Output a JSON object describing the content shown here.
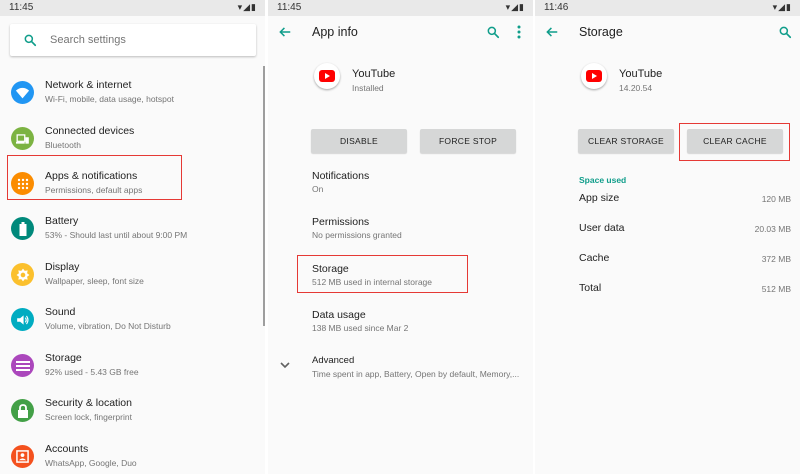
{
  "colors": {
    "network": "#2196f3",
    "connected": "#7cb342",
    "apps": "#fb8c00",
    "battery": "#00897b",
    "display": "#fbc02d",
    "sound": "#00acc1",
    "storage": "#ab47bc",
    "security": "#43a047",
    "accounts": "#f4511e",
    "accent": "#0f9d8a",
    "highlight": "#e53935",
    "youtube": "#ff0000"
  },
  "panel1": {
    "status_time": "11:45",
    "search_placeholder": "Search settings",
    "items": [
      {
        "title": "Network & internet",
        "sub": "Wi-Fi, mobile, data usage, hotspot",
        "icon": "wifi-icon"
      },
      {
        "title": "Connected devices",
        "sub": "Bluetooth",
        "icon": "devices-icon"
      },
      {
        "title": "Apps & notifications",
        "sub": "Permissions, default apps",
        "icon": "apps-grid-icon"
      },
      {
        "title": "Battery",
        "sub": "53% - Should last until about 9:00 PM",
        "icon": "battery-icon"
      },
      {
        "title": "Display",
        "sub": "Wallpaper, sleep, font size",
        "icon": "brightness-icon"
      },
      {
        "title": "Sound",
        "sub": "Volume, vibration, Do Not Disturb",
        "icon": "volume-icon"
      },
      {
        "title": "Storage",
        "sub": "92% used - 5.43 GB free",
        "icon": "storage-icon"
      },
      {
        "title": "Security & location",
        "sub": "Screen lock, fingerprint",
        "icon": "lock-icon"
      },
      {
        "title": "Accounts",
        "sub": "WhatsApp, Google, Duo",
        "icon": "account-icon"
      }
    ]
  },
  "panel2": {
    "status_time": "11:45",
    "title": "App info",
    "app_name": "YouTube",
    "app_status": "Installed",
    "btn_disable": "DISABLE",
    "btn_force_stop": "FORCE STOP",
    "items": [
      {
        "title": "Notifications",
        "sub": "On"
      },
      {
        "title": "Permissions",
        "sub": "No permissions granted"
      },
      {
        "title": "Storage",
        "sub": "512 MB used in internal storage"
      },
      {
        "title": "Data usage",
        "sub": "138 MB used since Mar 2"
      },
      {
        "title": "Advanced",
        "sub": "Time spent in app, Battery, Open by default, Memory,..."
      }
    ]
  },
  "panel3": {
    "status_time": "11:46",
    "title": "Storage",
    "app_name": "YouTube",
    "app_version": "14.20.54",
    "btn_clear_storage": "CLEAR STORAGE",
    "btn_clear_cache": "CLEAR CACHE",
    "section": "Space used",
    "rows": [
      {
        "label": "App size",
        "value": "120 MB"
      },
      {
        "label": "User data",
        "value": "20.03 MB"
      },
      {
        "label": "Cache",
        "value": "372 MB"
      },
      {
        "label": "Total",
        "value": "512 MB"
      }
    ]
  }
}
